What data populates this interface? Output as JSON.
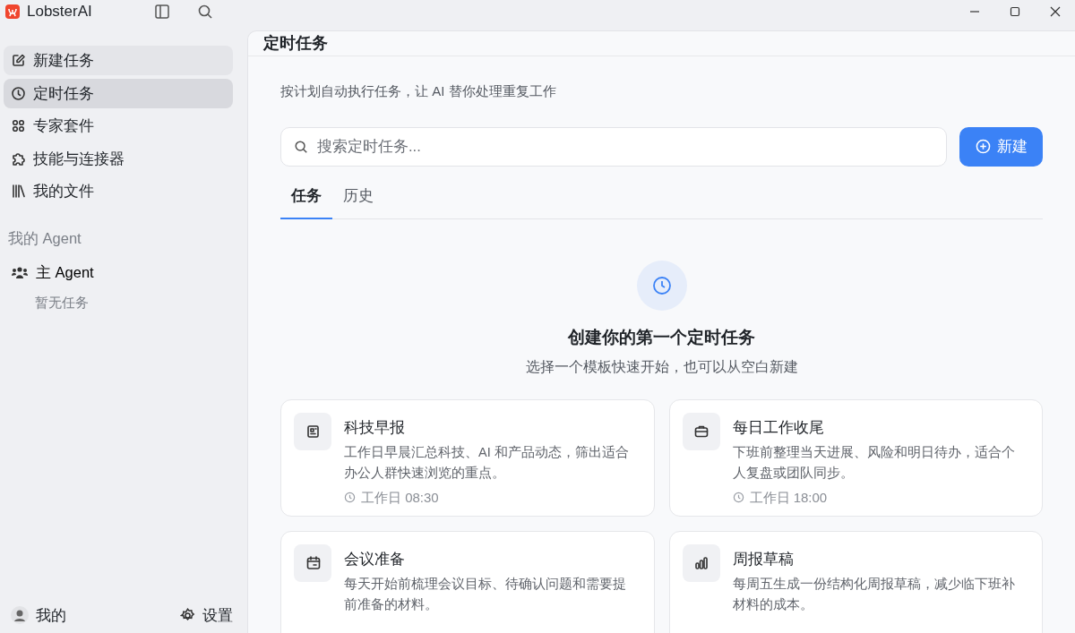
{
  "app": {
    "title": "LobsterAI"
  },
  "sidebar": {
    "items": [
      {
        "label": "新建任务",
        "kind": "new",
        "selected": false
      },
      {
        "label": "定时任务",
        "kind": "clock",
        "selected": true
      },
      {
        "label": "专家套件",
        "kind": "grid",
        "selected": false
      },
      {
        "label": "技能与连接器",
        "kind": "puzzle",
        "selected": false
      },
      {
        "label": "我的文件",
        "kind": "books",
        "selected": false
      }
    ],
    "agents_heading": "我的 Agent",
    "agents": [
      {
        "name": "主 Agent",
        "empty_note": "暂无任务"
      }
    ],
    "footer": {
      "profile": "我的",
      "settings": "设置"
    }
  },
  "main": {
    "title": "定时任务",
    "description": "按计划自动执行任务，让 AI 替你处理重复工作",
    "search": {
      "placeholder": "搜索定时任务..."
    },
    "new_button": "新建",
    "tabs": [
      {
        "label": "任务",
        "selected": true
      },
      {
        "label": "历史",
        "selected": false
      }
    ],
    "empty_state": {
      "heading": "创建你的第一个定时任务",
      "subheading": "选择一个模板快速开始，也可以从空白新建"
    },
    "templates": [
      {
        "kind": "news",
        "title": "科技早报",
        "description": "工作日早晨汇总科技、AI 和产品动态，筛出适合办公人群快速浏览的重点。",
        "schedule": "工作日 08:30"
      },
      {
        "kind": "briefcase",
        "title": "每日工作收尾",
        "description": "下班前整理当天进展、风险和明日待办，适合个人复盘或团队同步。",
        "schedule": "工作日 18:00"
      },
      {
        "kind": "calendar",
        "title": "会议准备",
        "description": "每天开始前梳理会议目标、待确认问题和需要提前准备的材料。"
      },
      {
        "kind": "chart",
        "title": "周报草稿",
        "description": "每周五生成一份结构化周报草稿，减少临下班补材料的成本。"
      }
    ]
  }
}
